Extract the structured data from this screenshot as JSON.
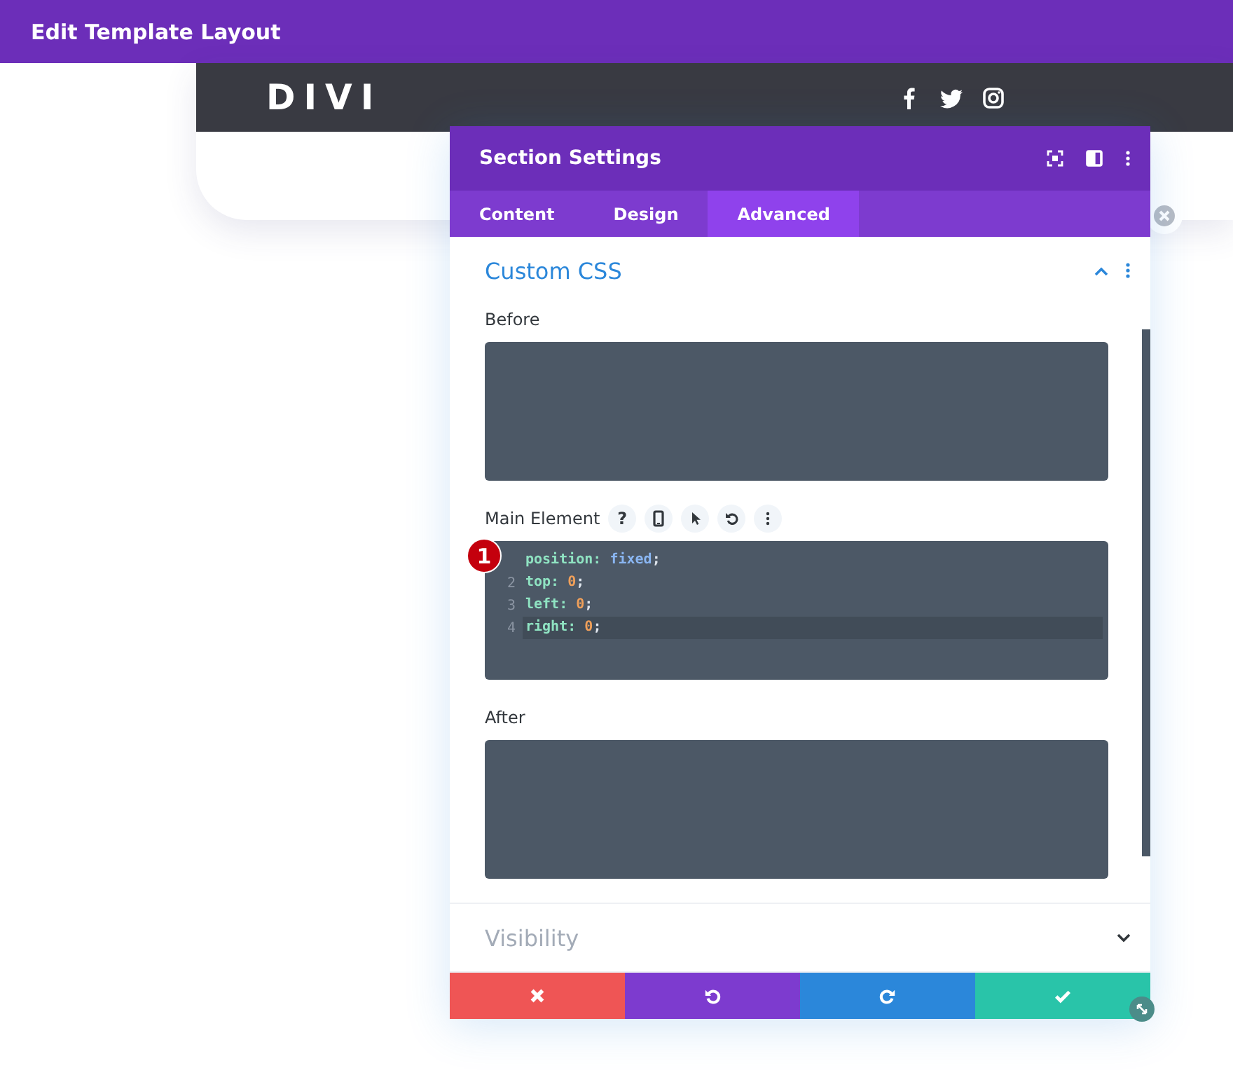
{
  "topbar": {
    "title": "Edit Template Layout"
  },
  "site_header": {
    "logo": "DIVI"
  },
  "modal": {
    "title": "Section Settings",
    "tabs": [
      {
        "label": "Content",
        "selected": false
      },
      {
        "label": "Design",
        "selected": false
      },
      {
        "label": "Advanced",
        "selected": true
      }
    ],
    "groups": [
      {
        "title": "Custom CSS",
        "expanded": true,
        "fields": [
          {
            "label": "Before"
          },
          {
            "label": "Main Element",
            "help": "?",
            "badge": "1",
            "lines": [
              {
                "active": false,
                "tokens": [
                  {
                    "kind": "property",
                    "text": "position:"
                  },
                  {
                    "kind": "keyword",
                    "text": "fixed"
                  },
                  {
                    "kind": "punct",
                    "text": ";"
                  }
                ]
              },
              {
                "number": "2",
                "active": false,
                "tokens": [
                  {
                    "kind": "property",
                    "text": "top:"
                  },
                  {
                    "kind": "number",
                    "text": "0"
                  },
                  {
                    "kind": "punct",
                    "text": ";"
                  }
                ]
              },
              {
                "number": "3",
                "active": false,
                "tokens": [
                  {
                    "kind": "property",
                    "text": "left:"
                  },
                  {
                    "kind": "number",
                    "text": "0"
                  },
                  {
                    "kind": "punct",
                    "text": ";"
                  }
                ]
              },
              {
                "number": "4",
                "active": true,
                "tokens": [
                  {
                    "kind": "property",
                    "text": "right:"
                  },
                  {
                    "kind": "number",
                    "text": "0"
                  },
                  {
                    "kind": "punct",
                    "text": ";"
                  }
                ]
              }
            ]
          },
          {
            "label": "After"
          }
        ]
      },
      {
        "title": "Visibility",
        "expanded": false
      }
    ],
    "footer": [
      {
        "kind": "cancel"
      },
      {
        "kind": "undo"
      },
      {
        "kind": "redo"
      },
      {
        "kind": "save"
      }
    ]
  }
}
